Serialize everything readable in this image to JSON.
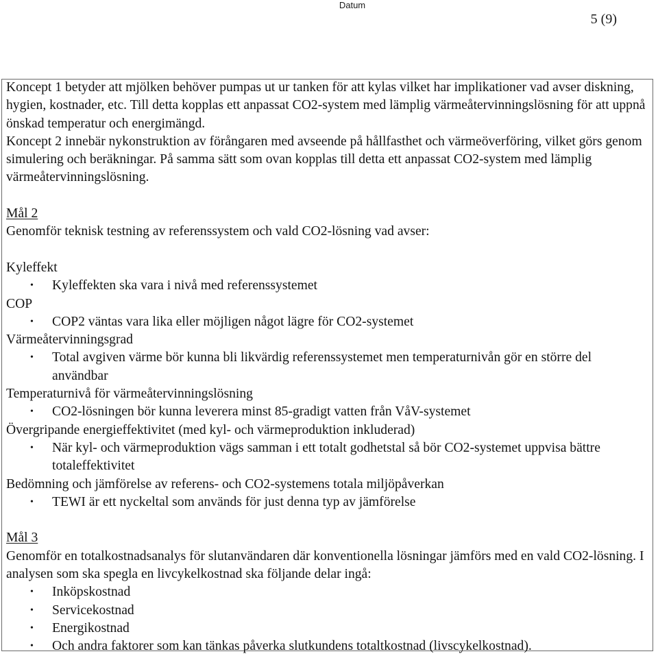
{
  "header": {
    "date_label": "Datum",
    "page_number": "5 (9)"
  },
  "intro": {
    "paragraph": "Koncept 1 betyder att mjölken behöver pumpas ut ur tanken för att kylas vilket har implikationer vad avser diskning, hygien, kostnader, etc. Till detta kopplas ett anpassat CO2-system med lämplig värmeåtervinningslösning för att uppnå önskad temperatur och energimängd.",
    "paragraph2": "Koncept 2 innebär nykonstruktion av förångaren med avseende på hållfasthet och värmeöverföring, vilket görs genom simulering och beräkningar. På samma sätt som ovan kopplas till detta ett anpassat CO2-system med lämplig värmeåtervinningslösning."
  },
  "goal2": {
    "heading": "Mål 2",
    "intro": "Genomför teknisk testning av referenssystem och vald CO2-lösning vad avser:",
    "sections": [
      {
        "title": "Kyleffekt",
        "bullets": [
          "Kyleffekten ska vara i nivå med referenssystemet"
        ]
      },
      {
        "title": "COP",
        "bullets": [
          "COP2 väntas vara lika eller möjligen något lägre för CO2-systemet"
        ]
      },
      {
        "title": "Värmeåtervinningsgrad",
        "bullets": [
          "Total avgiven värme bör kunna bli likvärdig referenssystemet men temperaturnivån gör en större del användbar"
        ]
      },
      {
        "title": "Temperaturnivå för värmeåtervinningslösning",
        "bullets": [
          "CO2-lösningen bör kunna leverera minst 85-gradigt vatten från VåV-systemet"
        ]
      },
      {
        "title": "Övergripande energieffektivitet (med kyl- och värmeproduktion inkluderad)",
        "bullets": [
          "När kyl- och värmeproduktion vägs samman i ett totalt godhetstal så bör CO2-systemet uppvisa bättre totaleffektivitet"
        ]
      },
      {
        "title": "Bedömning och jämförelse av referens- och CO2-systemens totala miljöpåverkan",
        "bullets": [
          "TEWI är ett nyckeltal som används för just denna typ av jämförelse"
        ]
      }
    ]
  },
  "goal3": {
    "heading": "Mål 3",
    "intro": "Genomför en totalkostnadsanalys för slutanvändaren där konventionella lösningar jämförs med en vald CO2-lösning. I analysen som ska spegla en livcykelkostnad ska följande delar ingå:",
    "bullets": [
      "Inköpskostnad",
      "Servicekostnad",
      "Energikostnad",
      "Och andra faktorer som kan tänkas påverka slutkundens totaltkostnad (livscykelkostnad)."
    ]
  },
  "bullet_glyph": "•"
}
